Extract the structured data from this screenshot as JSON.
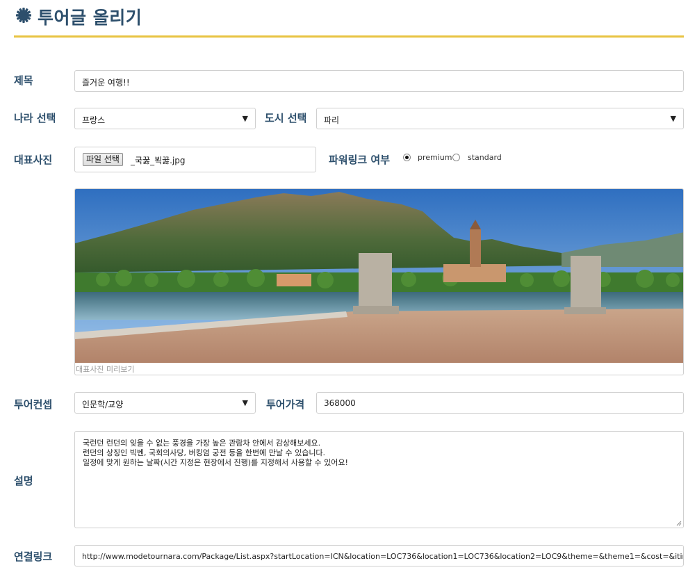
{
  "page": {
    "title": "투어글 올리기",
    "icon": "gear-icon"
  },
  "colors": {
    "accent": "#e8c341",
    "heading": "#2d4f6c"
  },
  "form": {
    "title_label": "제목",
    "title_value": "즐거운 여행!!",
    "country_label": "나라 선택",
    "country_value": "프랑스",
    "city_label": "도시 선택",
    "city_value": "파리",
    "photo_label": "대표사진",
    "file_button": "파일 선택",
    "file_name": "_국꿇_뵉꿇.jpg",
    "powerlink_label": "파워링크 여부",
    "powerlink_options": [
      "premium",
      "standard"
    ],
    "powerlink_selected": "premium",
    "preview_caption": "대표사진 미리보기",
    "concept_label": "투어컨셉",
    "concept_value": "인문학/교양",
    "price_label": "투어가격",
    "price_value": "368000",
    "description_label": "설명",
    "description_lines": [
      "국런던 런던의 잊을 수 없는 풍경을 가장 높은 관람차 안에서 감상해보세요.",
      "런던의 상징인 빅벤, 국회의사당, 버킹엄 궁전 등을 한번에 만날 수 있습니다.",
      "일정에 맞게 원하는 날짜(시간 지정은 현장에서 진행)를 지정해서 사용할 수 있어요!"
    ],
    "link_label": "연결링크",
    "link_value": "http://www.modetournara.com/Package/List.aspx?startLocation=ICN&location=LOC736&location1=LOC736&location2=LOC9&theme=&theme1=&cost=&itinerary=&"
  }
}
